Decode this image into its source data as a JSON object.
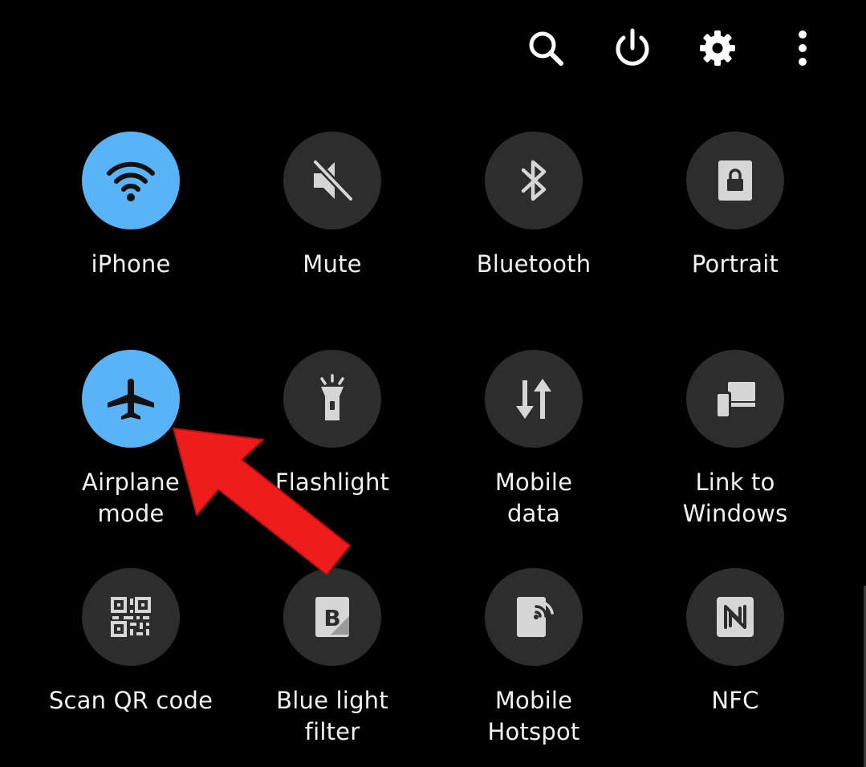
{
  "top_icons": [
    "search-icon",
    "power-icon",
    "gear-icon",
    "more-vertical-icon"
  ],
  "tiles": [
    {
      "line1": "iPhone",
      "line2": "",
      "icon": "wifi-icon",
      "active": true
    },
    {
      "line1": "Mute",
      "line2": "",
      "icon": "mute-icon",
      "active": false
    },
    {
      "line1": "Bluetooth",
      "line2": "",
      "icon": "bluetooth-icon",
      "active": false
    },
    {
      "line1": "Portrait",
      "line2": "",
      "icon": "portrait-lock-icon",
      "active": false
    },
    {
      "line1": "Airplane",
      "line2": "mode",
      "icon": "airplane-icon",
      "active": true
    },
    {
      "line1": "Flashlight",
      "line2": "",
      "icon": "flashlight-icon",
      "active": false
    },
    {
      "line1": "Mobile",
      "line2": "data",
      "icon": "mobile-data-icon",
      "active": false
    },
    {
      "line1": "Link to",
      "line2": "Windows",
      "icon": "link-to-windows-icon",
      "active": false
    },
    {
      "line1": "Scan QR code",
      "line2": "",
      "icon": "qr-code-icon",
      "active": false
    },
    {
      "line1": "Blue light",
      "line2": "filter",
      "icon": "blue-light-filter-icon",
      "active": false
    },
    {
      "line1": "Mobile",
      "line2": "Hotspot",
      "icon": "hotspot-icon",
      "active": false
    },
    {
      "line1": "NFC",
      "line2": "",
      "icon": "nfc-icon",
      "active": false
    }
  ],
  "colors": {
    "background": "#000000",
    "tile_off": "#2d2d2d",
    "tile_on": "#5ab2f7",
    "icon_off": "#d6d6d6",
    "icon_on": "#111111",
    "label": "#f2f2f2",
    "arrow": "#ee1c1c"
  },
  "annotation": {
    "type": "arrow",
    "points_to": "Airplane mode"
  }
}
